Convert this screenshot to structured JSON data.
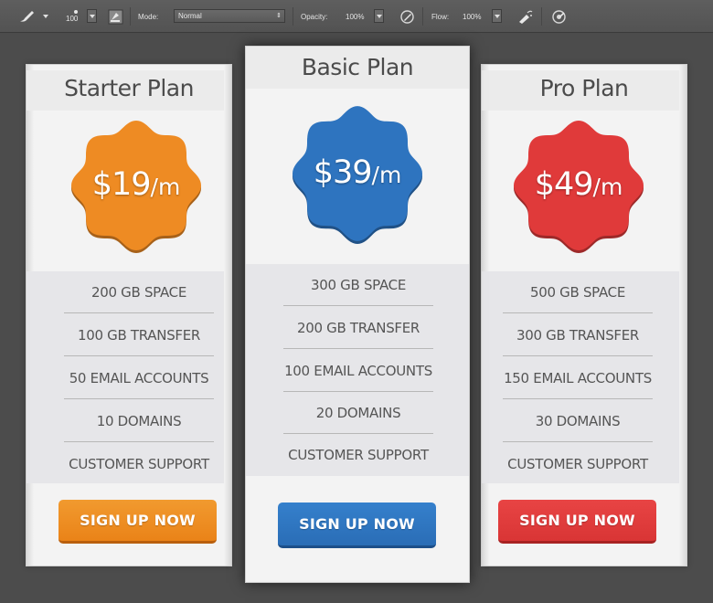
{
  "toolbar": {
    "brush_size": "100",
    "mode_label": "Mode:",
    "mode_value": "Normal",
    "opacity_label": "Opacity:",
    "opacity_value": "100%",
    "flow_label": "Flow:",
    "flow_value": "100%",
    "icons": [
      "brush-tool-icon",
      "brush-preset-icon",
      "brush-panel-icon",
      "airbrush-icon",
      "pressure-icon",
      "pressure-size-icon"
    ]
  },
  "plans": [
    {
      "title": "Starter Plan",
      "price_amount": "$19",
      "price_period": "/m",
      "color": "#ee8b23",
      "features": [
        "200 GB SPACE",
        "100 GB TRANSFER",
        "50 EMAIL ACCOUNTS",
        "10 DOMAINS",
        "CUSTOMER SUPPORT"
      ],
      "cta": "SIGN UP NOW"
    },
    {
      "title": "Basic Plan",
      "price_amount": "$39",
      "price_period": "/m",
      "color": "#2e74bf",
      "features": [
        "300 GB SPACE",
        "200 GB TRANSFER",
        "100 EMAIL ACCOUNTS",
        "20 DOMAINS",
        "CUSTOMER SUPPORT"
      ],
      "cta": "SIGN UP NOW"
    },
    {
      "title": "Pro Plan",
      "price_amount": "$49",
      "price_period": "/m",
      "color": "#e03a3a",
      "features": [
        "500 GB SPACE",
        "300 GB TRANSFER",
        "150 EMAIL ACCOUNTS",
        "30 DOMAINS",
        "CUSTOMER SUPPORT"
      ],
      "cta": "SIGN UP NOW"
    }
  ]
}
